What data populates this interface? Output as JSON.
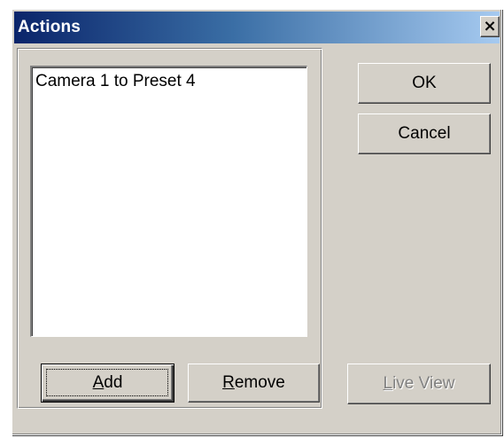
{
  "window": {
    "title": "Actions",
    "close_glyph": "×"
  },
  "actions_list": {
    "items": [
      "Camera 1 to Preset 4"
    ]
  },
  "buttons": {
    "ok": "OK",
    "cancel": "Cancel",
    "add": {
      "mnemonic": "A",
      "rest": "dd"
    },
    "remove": {
      "mnemonic": "R",
      "rest": "emove"
    },
    "live_view": {
      "mnemonic": "L",
      "rest": "ive View",
      "disabled": true
    }
  },
  "colors": {
    "title_gradient_start": "#0a246a",
    "title_gradient_end": "#a6caf0",
    "face": "#d4d0c8"
  }
}
